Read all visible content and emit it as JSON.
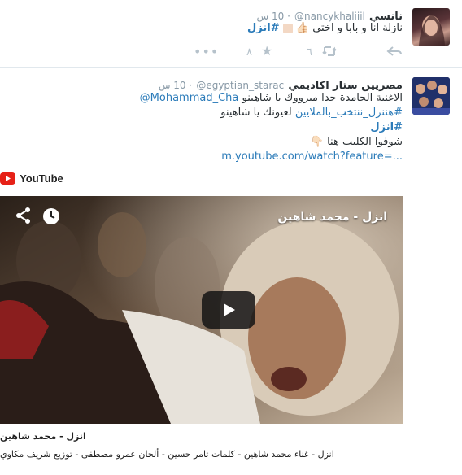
{
  "tweet1": {
    "name": "نانسي",
    "handle": "@nancykhaliiil",
    "time": "· 10 س",
    "text": "نازلة انا و بابا و اختي 👍🏻",
    "hashtag": "#انزل",
    "counts": {
      "retweets": "٦",
      "favorites": "٨"
    }
  },
  "tweet2": {
    "name": "مصريين ستار اكاديمي",
    "handle": "@egyptian_starac",
    "time": "· 10 س",
    "line1": "الاغنية الجامدة جدا مبرووك يا شاهينو",
    "mention": "@Mohammad_Cha",
    "line2_tag": "#هننزل_ننتخب_بالملايين",
    "line2_text": "لعيونك يا شاهينو",
    "line3_tag": "#انزل",
    "line4": "شوفوا الكليب هنا 👇🏻",
    "link": "m.youtube.com/watch?feature=..."
  },
  "youtube": {
    "brand": "YouTube",
    "video_title": "انزل - محمد شاهين",
    "caption_title": "انزل - محمد شاهين",
    "caption_desc": "انزل - غناء محمد شاهين - كلمات تامر حسين - ألحان عمرو مصطفى - توزيع شريف مكاوي"
  },
  "colors": {
    "link": "#2b7bb9",
    "youtube_red": "#e62117",
    "muted": "#8899a6"
  }
}
